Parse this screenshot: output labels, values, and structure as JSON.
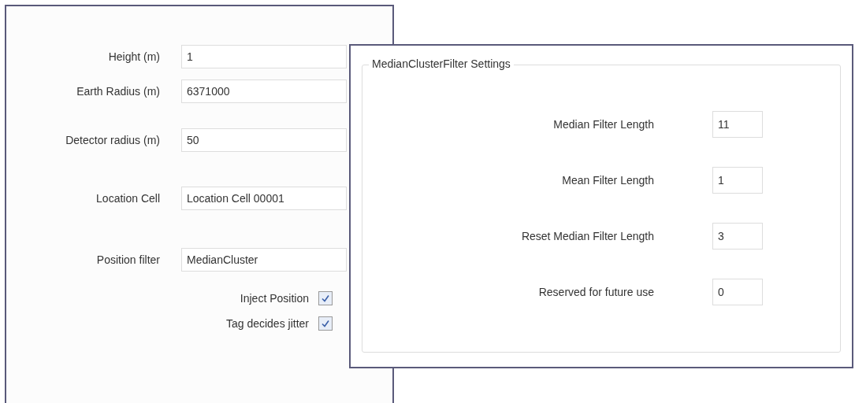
{
  "main_panel": {
    "fields": [
      {
        "label": "Height (m)",
        "value": "1"
      },
      {
        "label": "Earth Radius (m)",
        "value": "6371000"
      },
      {
        "label": "Detector radius (m)",
        "value": "50"
      },
      {
        "label": "Location Cell",
        "value": "Location Cell 00001"
      },
      {
        "label": "Position filter",
        "value": "MedianCluster"
      }
    ],
    "checkboxes": [
      {
        "label": "Inject Position",
        "checked": true
      },
      {
        "label": "Tag decides jitter",
        "checked": true
      }
    ]
  },
  "settings_dialog": {
    "group_title": "MedianClusterFilter Settings",
    "fields": [
      {
        "label": "Median Filter Length",
        "value": "11"
      },
      {
        "label": "Mean Filter Length",
        "value": "1"
      },
      {
        "label": "Reset Median Filter Length",
        "value": "3"
      },
      {
        "label": "Reserved for future use",
        "value": "0"
      }
    ]
  }
}
